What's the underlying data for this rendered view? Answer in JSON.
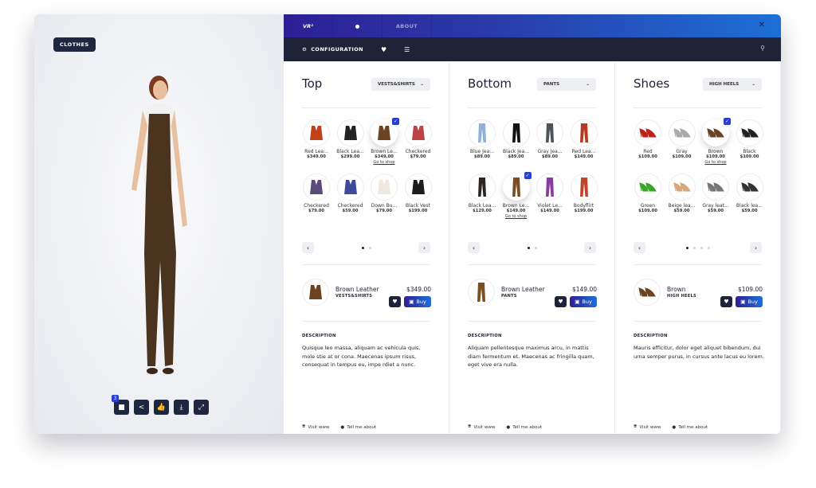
{
  "left": {
    "tag": "CLOTHES",
    "tools": [
      {
        "icon": "video-icon",
        "glyph": "■",
        "badge": "3"
      },
      {
        "icon": "share-icon",
        "glyph": "<"
      },
      {
        "icon": "thumbs-up-icon",
        "glyph": "👍"
      },
      {
        "icon": "download-icon",
        "glyph": "⤓"
      },
      {
        "icon": "expand-icon",
        "glyph": "⤢"
      }
    ]
  },
  "header": {
    "logo": "VR²",
    "about": "ABOUT",
    "close": "✕",
    "config": "CONFIGURATION"
  },
  "colors": {
    "accent": "#2a3fd0",
    "dark": "#1f2337",
    "gradient_start": "#2d1f96",
    "gradient_end": "#1d6fd6"
  },
  "columns": [
    {
      "title": "Top",
      "select": "VESTS&SHIRTS",
      "kind": "vest",
      "items": [
        {
          "name": "Red Lea...",
          "price": "$349.00",
          "color": "#c2401c"
        },
        {
          "name": "Black Lea...",
          "price": "$299.00",
          "color": "#222"
        },
        {
          "name": "Brown Le...",
          "price": "$349.00",
          "color": "#6b4322",
          "selected": true,
          "link": "Go to shop"
        },
        {
          "name": "Checkered",
          "price": "$79.00",
          "color": "#b44"
        },
        {
          "name": "Checkered",
          "price": "$79.00",
          "color": "#5a4a7a"
        },
        {
          "name": "Checkered",
          "price": "$59.00",
          "color": "#3e4a9a"
        },
        {
          "name": "Down Bu...",
          "price": "$79.00",
          "color": "#eee9dc"
        },
        {
          "name": "Black Vest",
          "price": "$199.00",
          "color": "#1c1c1c"
        }
      ],
      "pages": 2,
      "page": 1,
      "chosen": {
        "name": "Brown Leather",
        "category": "VESTS&SHIRTS",
        "price": "$349.00",
        "color": "#6b4322"
      },
      "buy": "Buy",
      "desc_label": "DESCRIPTION",
      "description": "Quisque leo massa, aliquam ac vehicula quis, mole stie at or cona. Maecenas ipsum risus, consequat in tempus eu, impe rdiet a nunc.",
      "visit": "Visit www",
      "tell": "Tell me about"
    },
    {
      "title": "Bottom",
      "select": "PANTS",
      "kind": "pants",
      "items": [
        {
          "name": "Blue Jea...",
          "price": "$89.00",
          "color": "#8fb2d6"
        },
        {
          "name": "Black Jea...",
          "price": "$89.00",
          "color": "#111"
        },
        {
          "name": "Gray Jea...",
          "price": "$89.00",
          "color": "#4a555a"
        },
        {
          "name": "Red Lea...",
          "price": "$149.00",
          "color": "#b63a22"
        },
        {
          "name": "Black Lea...",
          "price": "$129.00",
          "color": "#2a2622"
        },
        {
          "name": "Brown Le...",
          "price": "$149.00",
          "color": "#7a4e22",
          "selected": true,
          "link": "Go to shop"
        },
        {
          "name": "Violet Le...",
          "price": "$149.00",
          "color": "#8a3d9e"
        },
        {
          "name": "Bodyflirt",
          "price": "$199.00",
          "color": "#c0442a"
        }
      ],
      "pages": 2,
      "page": 1,
      "chosen": {
        "name": "Brown Leather",
        "category": "PANTS",
        "price": "$149.00",
        "color": "#7a4e22"
      },
      "buy": "Buy",
      "desc_label": "DESCRIPTION",
      "description": "Aliquam pellentesque maximus arcu, in mattis diam fermentum et. Maecenas ac fringilla quam, eget vive era nulla.",
      "visit": "Visit www",
      "tell": "Tell me about"
    },
    {
      "title": "Shoes",
      "select": "HIGH HEELS",
      "kind": "shoe",
      "items": [
        {
          "name": "Red",
          "price": "$109.00",
          "color": "#c0201c"
        },
        {
          "name": "Gray",
          "price": "$109.00",
          "color": "#aaa"
        },
        {
          "name": "Brown",
          "price": "$109.00",
          "color": "#6b4322",
          "selected": true,
          "link": "Go to shop"
        },
        {
          "name": "Black",
          "price": "$109.00",
          "color": "#222"
        },
        {
          "name": "Green",
          "price": "$109.00",
          "color": "#3aa52a"
        },
        {
          "name": "Beige lea...",
          "price": "$59.00",
          "color": "#d9a57a"
        },
        {
          "name": "Gray leat...",
          "price": "$59.00",
          "color": "#777"
        },
        {
          "name": "Black lea...",
          "price": "$59.00",
          "color": "#333"
        }
      ],
      "pages": 4,
      "page": 1,
      "chosen": {
        "name": "Brown",
        "category": "HIGH HEELS",
        "price": "$109.00",
        "color": "#6b4322"
      },
      "buy": "Buy",
      "desc_label": "DESCRIPTION",
      "description": "Mauris efficitur, dolor eget aliquet bibendum, dui urna semper purus, in cursus ante lacus eu lorem.",
      "visit": "Visit www",
      "tell": "Tell me about"
    }
  ]
}
